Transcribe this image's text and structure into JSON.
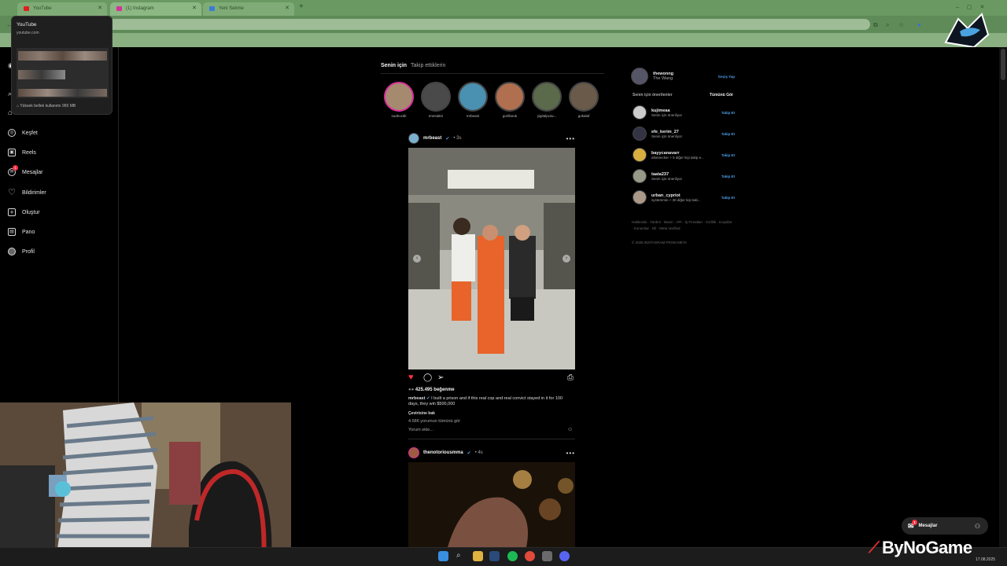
{
  "browser": {
    "tabs": [
      {
        "title": "YouTube",
        "color": "#e02020"
      },
      {
        "title": "(1) Instagram",
        "color": "#d6309a"
      },
      {
        "title": "Yeni Sekme",
        "color": "#3a7bd5"
      }
    ],
    "new_tab": "+"
  },
  "hover_card": {
    "title": "YouTube",
    "url": "youtube.com",
    "memory": "Yüksek bellek kullanımı 965 MB"
  },
  "sidebar": {
    "items": [
      {
        "label": "Keşfet",
        "icon": "compass-icon",
        "glyph": "◎"
      },
      {
        "label": "Reels",
        "icon": "reels-icon",
        "glyph": "▣"
      },
      {
        "label": "Mesajlar",
        "icon": "messenger-icon",
        "glyph": "✉",
        "badge": "1"
      },
      {
        "label": "Bildirimler",
        "icon": "heart-icon",
        "glyph": "♡"
      },
      {
        "label": "Oluştur",
        "icon": "plus-icon",
        "glyph": "+"
      },
      {
        "label": "Pano",
        "icon": "dashboard-icon",
        "glyph": "▤"
      },
      {
        "label": "Profil",
        "icon": "avatar-icon",
        "glyph": "●"
      }
    ]
  },
  "feed": {
    "tabs": [
      "Senin için",
      "Takip ettiklerin"
    ],
    "stories": [
      {
        "name": "sudeucitk"
      },
      {
        "name": "enestakir"
      },
      {
        "name": "mrbeast"
      },
      {
        "name": "gorillaruk"
      },
      {
        "name": "yigitalpcav..."
      },
      {
        "name": "gokalaf"
      }
    ],
    "post1": {
      "user": "mrbeast",
      "time": "• 3s",
      "likes": "425.495 beğenme",
      "caption_user": "mrbeast",
      "caption": "I built a prison and if this real cop and real convict stayed in it for 100 days, they win $500,000",
      "translate": "Çevirisine bak",
      "comments": "4.686 yorumun tümünü gör",
      "add_comment": "Yorum ekle..."
    },
    "post2": {
      "user": "thenotoriousmma",
      "time": "• 4s"
    }
  },
  "right": {
    "me": {
      "username": "thewonng",
      "name": "The Wang",
      "switch": "Geçiş Yap"
    },
    "suggest_title": "Senin için önerilenler",
    "see_all": "Tümünü Gör",
    "suggestions": [
      {
        "user": "kujimeaa",
        "sub": "Senin için öneriliyor",
        "action": "Takip Et"
      },
      {
        "user": "efe_kerim_27",
        "sub": "Senin için öneriliyor",
        "action": "Takip Et"
      },
      {
        "user": "bayycanavarr",
        "sub": "afsenecker + 5 diğer kişi takip e...",
        "action": "Takip Et"
      },
      {
        "user": "taata237",
        "sub": "Senin için öneriliyor",
        "action": "Takip Et"
      },
      {
        "user": "urban_cypriot",
        "sub": "systemmin + 30 diğer kişi taki...",
        "action": "Takip Et"
      }
    ],
    "footer_links": "Hakkında · Yardım · Basın · API · İş Fırsatları · Gizlilik · Koşullar · Konumlar · Dil · Meta Verified",
    "copyright": "© 2025 INSTAGRAM FROM META"
  },
  "chat_button": {
    "label": "Mesajlar",
    "badge": "1"
  },
  "watermark": {
    "brand": "ByNoGame",
    "date": "17.08.2025"
  }
}
